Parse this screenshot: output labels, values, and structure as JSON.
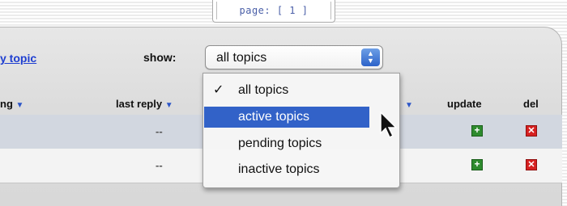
{
  "pagination": {
    "label": "page: [ 1 ]"
  },
  "toolbar": {
    "new_topic_link": "y topic",
    "show_label": "show:",
    "filter_select": {
      "selected_value": "all topics"
    }
  },
  "table": {
    "columns": [
      {
        "label": "ng",
        "sortable": true
      },
      {
        "label": "last reply",
        "sortable": true
      },
      {
        "label": "",
        "sortable": true
      },
      {
        "label": "update",
        "sortable": false
      },
      {
        "label": "del",
        "sortable": false
      }
    ],
    "rows": [
      {
        "last_reply": "--",
        "update_icon": "plus-icon",
        "del_icon": "x-icon"
      },
      {
        "last_reply": "--",
        "update_icon": "plus-icon",
        "del_icon": "x-icon"
      }
    ]
  },
  "dropdown_menu": {
    "items": [
      {
        "label": "all topics",
        "checked": true
      },
      {
        "label": "active topics",
        "highlighted": true
      },
      {
        "label": "pending topics"
      },
      {
        "label": "inactive topics"
      }
    ]
  },
  "colors": {
    "link": "#1f3fd1",
    "highlight": "#3262c8",
    "add_button": "#2e8b2e",
    "delete_button": "#d62020"
  }
}
